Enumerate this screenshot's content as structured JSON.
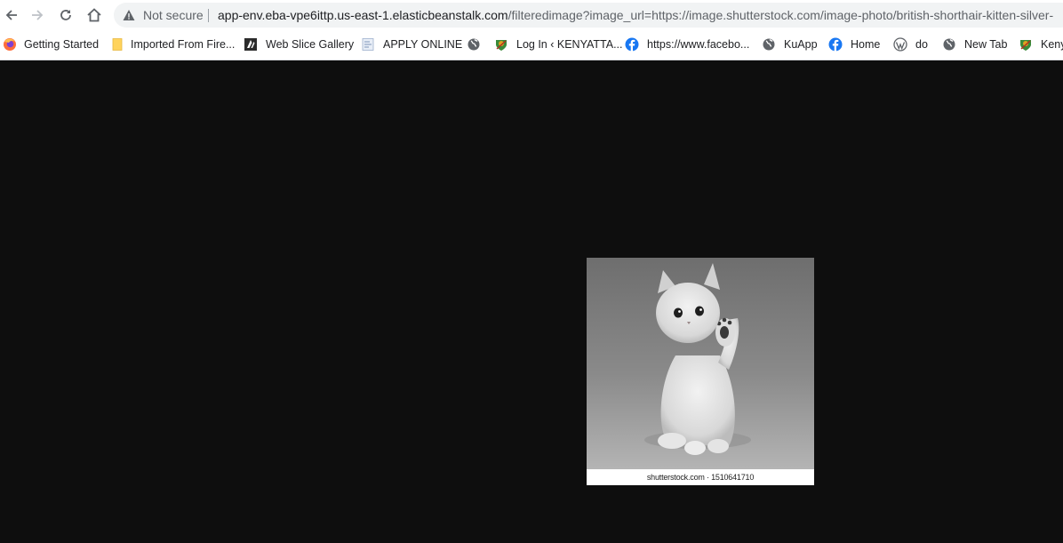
{
  "browser": {
    "security_label": "Not secure",
    "url": {
      "host": "app-env.eba-vpe6ittp.us-east-1.elasticbeanstalk.com",
      "path": "/filteredimage?image_url=https://image.shutterstock.com/image-photo/british-shorthair-kitten-silver-"
    },
    "nav": {
      "back_icon": "arrow-left-icon",
      "forward_icon": "arrow-right-icon",
      "reload_icon": "reload-icon",
      "home_icon": "home-icon"
    }
  },
  "bookmarks": [
    {
      "label": "Getting Started",
      "icon": "firefox-icon"
    },
    {
      "label": "Imported From Fire...",
      "icon": "folder-icon"
    },
    {
      "label": "Web Slice Gallery",
      "icon": "web-slice-icon"
    },
    {
      "label": "APPLY ONLINE",
      "icon": "page-icon"
    },
    {
      "label": "",
      "icon": "globe-icon"
    },
    {
      "label": "Log In ‹ KENYATTA...",
      "icon": "crest-icon"
    },
    {
      "label": "https://www.facebo...",
      "icon": "facebook-icon"
    },
    {
      "label": "KuApp",
      "icon": "globe-icon"
    },
    {
      "label": "Home",
      "icon": "facebook-icon"
    },
    {
      "label": "do",
      "icon": "wordpress-icon"
    },
    {
      "label": "New Tab",
      "icon": "globe-icon"
    },
    {
      "label": "Keny",
      "icon": "crest-icon"
    }
  ],
  "image": {
    "caption": "shutterstock.com · 1510641710",
    "subject": "grayscale kitten raising paw"
  },
  "colors": {
    "page_background": "#0e0e0e",
    "facebook": "#1877f2"
  }
}
